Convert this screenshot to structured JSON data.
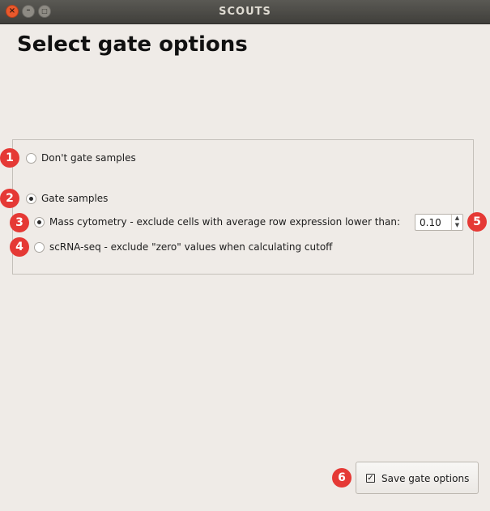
{
  "window": {
    "title": "SCOUTS",
    "close_glyph": "×",
    "min_glyph": "–",
    "max_glyph": "□"
  },
  "page": {
    "title": "Select gate options"
  },
  "options": {
    "dont_gate": {
      "label": "Don't gate samples",
      "checked": false
    },
    "gate": {
      "label": "Gate samples",
      "checked": true
    },
    "mass_cyto": {
      "label": "Mass cytometry - exclude cells with average row expression lower than:",
      "checked": true
    },
    "scrna": {
      "label": "scRNA-seq - exclude \"zero\" values when calculating cutoff",
      "checked": false
    }
  },
  "cutoff": {
    "value": "0.10",
    "up": "▲",
    "down": "▼"
  },
  "save": {
    "label": "Save gate options",
    "check_glyph": "✓"
  },
  "badges": [
    "1",
    "2",
    "3",
    "4",
    "5",
    "6"
  ],
  "colors": {
    "badge": "#e53935",
    "titlebar": "#403f3b",
    "background": "#efebe7",
    "close_button": "#e9592c"
  }
}
